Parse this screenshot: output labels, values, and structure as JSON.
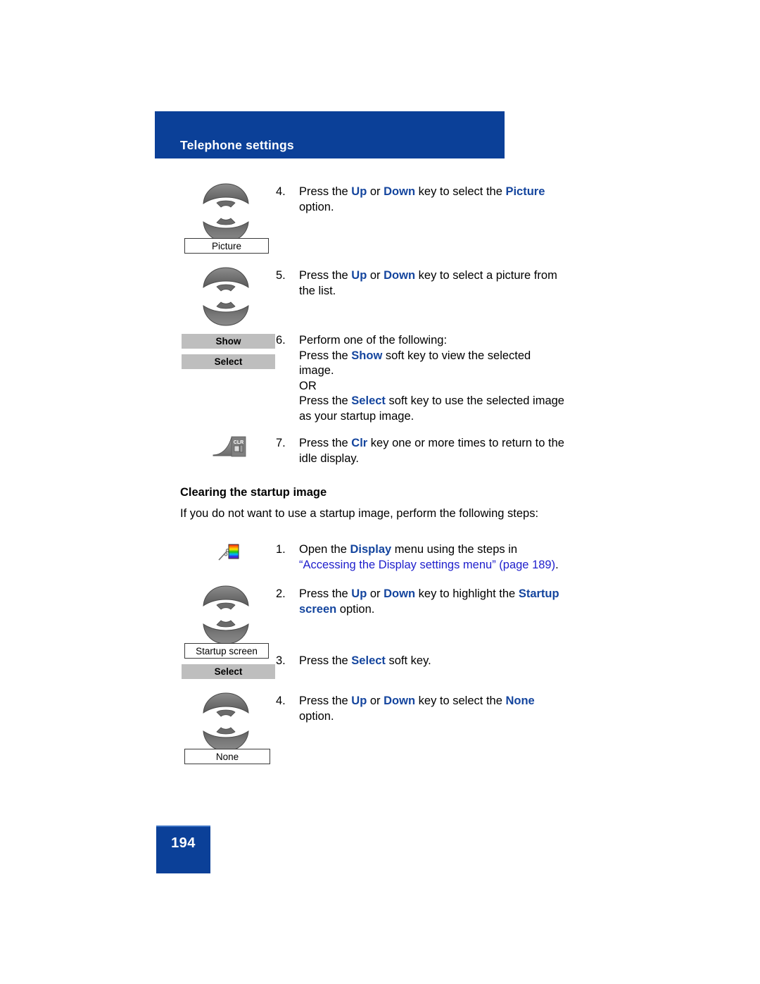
{
  "document": {
    "header_title": "Telephone settings",
    "page_number": "194",
    "colors": {
      "banner_blue": "#0B4098",
      "keyword_blue": "#14459E",
      "xref_blue": "#2020CC",
      "softkey_gray": "#BEBEBE"
    }
  },
  "section_picture": {
    "step4": {
      "number": "4.",
      "line1_pre": "Press the ",
      "kw_up": "Up",
      "mid_or": " or ",
      "kw_down": "Down",
      "line1_post": " key to select the ",
      "kw_target": "Picture",
      "line2": "option.",
      "icon_label": "Picture"
    },
    "step5": {
      "number": "5.",
      "line1_pre": "Press the ",
      "kw_up": "Up",
      "mid_or": " or ",
      "kw_down": "Down",
      "line1_post": " key to select a picture from",
      "line2": "the list."
    },
    "step6": {
      "number": "6.",
      "line1": "Perform one of the following:",
      "line2_pre": "Press the ",
      "kw_show": "Show",
      "line2_post": " soft key to view the selected",
      "line3": "image.",
      "line4": "OR",
      "line5_pre": "Press the ",
      "kw_select": "Select",
      "line5_post": " soft key to use the selected image",
      "line6": "as your startup image.",
      "softkey_show": "Show",
      "softkey_select": "Select"
    },
    "step7": {
      "number": "7.",
      "line1_pre": "Press the ",
      "kw_clr": "Clr",
      "line1_post": " key one or more times to return to the",
      "line2": "idle display.",
      "icon_glyph": "CLR"
    }
  },
  "section_clearing": {
    "heading": "Clearing the startup image",
    "intro": "If you do not want to use a startup image, perform the following steps:",
    "step1": {
      "number": "1.",
      "line1_pre": "Open the ",
      "kw_display": "Display",
      "line1_post": " menu using the steps in",
      "line2_xref": "“Accessing the Display settings menu” (page 189)",
      "line2_end": "."
    },
    "step2": {
      "number": "2.",
      "line1_pre": "Press the ",
      "kw_up": "Up",
      "mid_or": " or ",
      "kw_down": "Down",
      "line1_post": " key to highlight the ",
      "kw_target1": "Startup",
      "kw_target2": "screen",
      "line2_post": " option.",
      "icon_label": "Startup screen"
    },
    "step3": {
      "number": "3.",
      "line1_pre": "Press the ",
      "kw_select": "Select",
      "line1_post": " soft key.",
      "softkey_select": "Select"
    },
    "step4": {
      "number": "4.",
      "line1_pre": "Press the ",
      "kw_up": "Up",
      "mid_or": " or ",
      "kw_down": "Down",
      "line1_post": " key to select the ",
      "kw_target": "None",
      "line2": "option.",
      "icon_label": "None"
    }
  }
}
